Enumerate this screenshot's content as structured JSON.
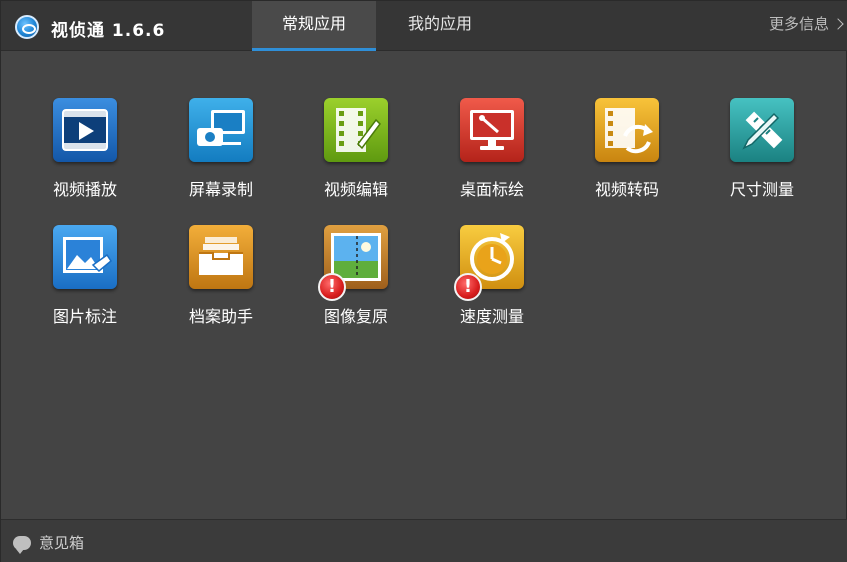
{
  "window": {
    "title": "视侦通 1.6.6"
  },
  "tabs": [
    {
      "label": "常规应用",
      "active": true
    },
    {
      "label": "我的应用",
      "active": false
    }
  ],
  "more_info": "更多信息",
  "apps": [
    {
      "label": "视频播放",
      "icon": "video-play-icon",
      "color": "#1e6fc7",
      "warning": false
    },
    {
      "label": "屏幕录制",
      "icon": "screen-record-icon",
      "color": "#1c8fd6",
      "warning": false
    },
    {
      "label": "视频编辑",
      "icon": "video-edit-icon",
      "color": "#7fba1b",
      "warning": false
    },
    {
      "label": "桌面标绘",
      "icon": "desktop-draw-icon",
      "color": "#d83a2c",
      "warning": false
    },
    {
      "label": "视频转码",
      "icon": "video-transcode-icon",
      "color": "#e3a51a",
      "warning": false
    },
    {
      "label": "尺寸测量",
      "icon": "size-measure-icon",
      "color": "#2aa5a5",
      "warning": false
    },
    {
      "label": "图片标注",
      "icon": "image-annotate-icon",
      "color": "#2d8fe0",
      "warning": false
    },
    {
      "label": "档案助手",
      "icon": "archive-assistant-icon",
      "color": "#e39a2a",
      "warning": false
    },
    {
      "label": "图像复原",
      "icon": "image-restore-icon",
      "color": "#c9852e",
      "warning": true
    },
    {
      "label": "速度测量",
      "icon": "speed-measure-icon",
      "color": "#e9b31f",
      "warning": true
    }
  ],
  "warning_symbol": "!",
  "footer": {
    "feedback_label": "意见箱"
  }
}
